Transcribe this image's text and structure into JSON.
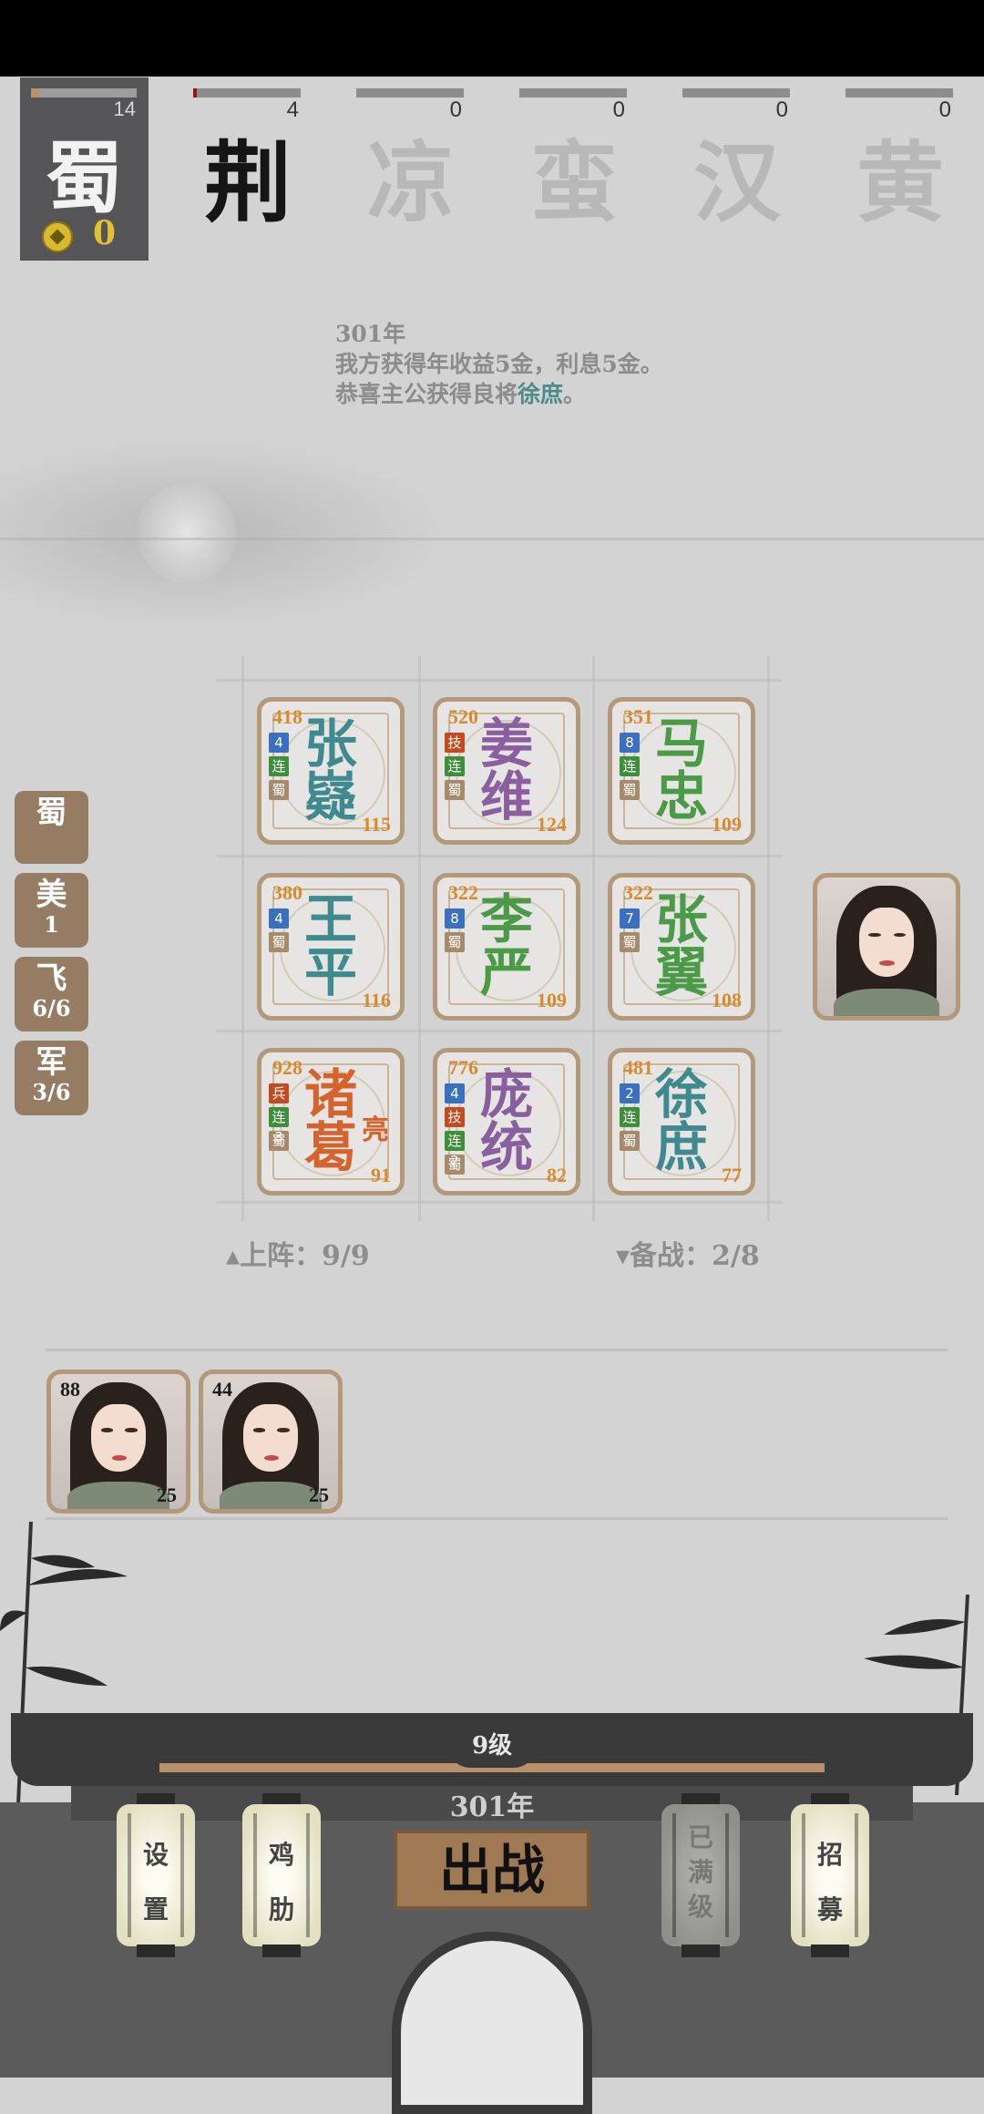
{
  "factions": {
    "active": {
      "name": "蜀",
      "count": "14",
      "gold": "0",
      "progress": 0.08
    },
    "others": [
      {
        "name": "荆",
        "count": "4",
        "progress": 0.03,
        "active": true
      },
      {
        "name": "凉",
        "count": "0",
        "progress": 0,
        "active": false
      },
      {
        "name": "蛮",
        "count": "0",
        "progress": 0,
        "active": false
      },
      {
        "name": "汉",
        "count": "0",
        "progress": 0,
        "active": false
      },
      {
        "name": "黄",
        "count": "0",
        "progress": 0,
        "active": false
      }
    ]
  },
  "log": {
    "year": "301年",
    "line1": "我方获得年收益5金，利息5金。",
    "line2_prefix": "恭喜主公获得良将",
    "line2_name": "徐庶",
    "line2_suffix": "。"
  },
  "generals": [
    {
      "n1": "张",
      "n2": "嶷",
      "power": "418",
      "level": "115",
      "color": "teal",
      "badges": [
        [
          "4",
          "blue"
        ],
        [
          "连",
          "green"
        ],
        [
          "蜀",
          "tan"
        ]
      ]
    },
    {
      "n1": "姜",
      "n2": "维",
      "power": "520",
      "level": "124",
      "color": "purple",
      "badges": [
        [
          "技",
          "red"
        ],
        [
          "连",
          "green"
        ],
        [
          "蜀",
          "tan"
        ]
      ]
    },
    {
      "n1": "马",
      "n2": "忠",
      "power": "351",
      "level": "109",
      "color": "green",
      "badges": [
        [
          "8",
          "blue"
        ],
        [
          "连",
          "green"
        ],
        [
          "蜀",
          "tan"
        ]
      ]
    },
    {
      "n1": "王",
      "n2": "平",
      "power": "380",
      "level": "116",
      "color": "teal",
      "badges": [
        [
          "4",
          "blue"
        ],
        [
          "蜀",
          "tan"
        ]
      ]
    },
    {
      "n1": "李",
      "n2": "严",
      "power": "322",
      "level": "109",
      "color": "green",
      "badges": [
        [
          "8",
          "blue"
        ],
        [
          "蜀",
          "tan"
        ]
      ]
    },
    {
      "n1": "张",
      "n2": "翼",
      "power": "322",
      "level": "108",
      "color": "green",
      "badges": [
        [
          "7",
          "blue"
        ],
        [
          "蜀",
          "tan"
        ]
      ]
    },
    {
      "n1": "诸",
      "n2": "葛",
      "extra": "亮",
      "power": "928",
      "level": "91",
      "color": "orange",
      "badges": [
        [
          "兵",
          "red"
        ],
        [
          "连3",
          "green"
        ],
        [
          "蜀",
          "tan"
        ]
      ]
    },
    {
      "n1": "庞",
      "n2": "统",
      "power": "776",
      "level": "82",
      "color": "purple",
      "badges": [
        [
          "4",
          "blue"
        ],
        [
          "技",
          "red"
        ],
        [
          "连2",
          "green"
        ],
        [
          "蜀",
          "tan"
        ]
      ]
    },
    {
      "n1": "徐",
      "n2": "庶",
      "power": "481",
      "level": "77",
      "color": "teal",
      "badges": [
        [
          "2",
          "blue"
        ],
        [
          "连",
          "green"
        ],
        [
          "蜀",
          "tan"
        ]
      ]
    }
  ],
  "side_tabs": [
    {
      "title": "蜀",
      "sub": ""
    },
    {
      "title": "美",
      "sub": "1"
    },
    {
      "title": "飞",
      "sub": "6/6"
    },
    {
      "title": "军",
      "sub": "3/6"
    }
  ],
  "formation": {
    "deployed": "▴上阵：9/9",
    "reserve": "▾备战：2/8"
  },
  "reserve_units": [
    {
      "top": "88",
      "bottom": "25"
    },
    {
      "top": "44",
      "bottom": "25"
    }
  ],
  "bottom": {
    "level": "9级",
    "year": "301年",
    "battle": "出战",
    "lanterns": [
      {
        "label": "设\n置",
        "dim": false
      },
      {
        "label": "鸡\n肋",
        "dim": false
      },
      {
        "label": "已\n满\n级",
        "dim": true
      },
      {
        "label": "招\n募",
        "dim": false
      }
    ]
  },
  "colors": {
    "teal": "#3f8a8e",
    "purple": "#8a5fa0",
    "green": "#4a9a48",
    "orange": "#d4642e",
    "card_border": "#b39979",
    "gold": "#e1c132"
  }
}
